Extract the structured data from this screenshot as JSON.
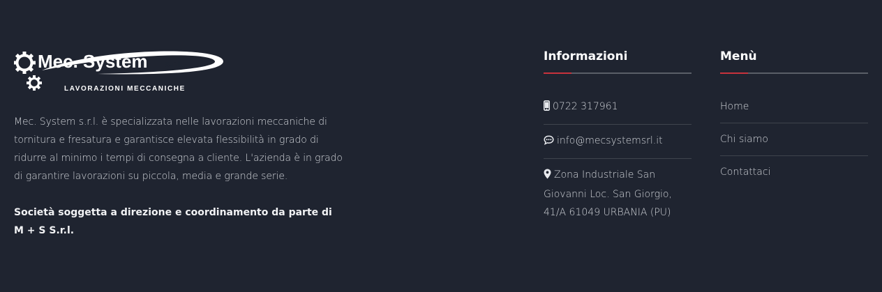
{
  "brand": {
    "name": "Mec. System",
    "suffix": "s.r.l.",
    "tagline": "LAVORAZIONI MECCANICHE"
  },
  "about": {
    "text": "Mec. System s.r.l. è specializzata nelle lavorazioni meccaniche di tornitura e fresatura e garantisce elevata flessibilità in grado di ridurre al minimo i tempi di consegna a cliente. L'azienda è in grado di garantire lavorazioni su piccola, media e grande serie.",
    "note": "Società soggetta a direzione e coordinamento da parte di M + S S.r.l."
  },
  "info": {
    "title": "Informazioni",
    "phone": "0722 317961",
    "email": "info@mecsystemsrl.it",
    "address": "Zona Industriale San Giovanni Loc. San Giorgio, 41/A 61049 URBANIA (PU)"
  },
  "menu": {
    "title": "Menù",
    "items": [
      "Home",
      "Chi siamo",
      "Contattaci"
    ]
  },
  "colors": {
    "background": "#1f2430",
    "accent": "#c8323c",
    "divider": "#3f444d"
  },
  "icons": {
    "phone": "mobile-phone-icon",
    "email": "chat-bubble-icon",
    "address": "map-marker-icon",
    "logo": "gear-logo-icon"
  }
}
